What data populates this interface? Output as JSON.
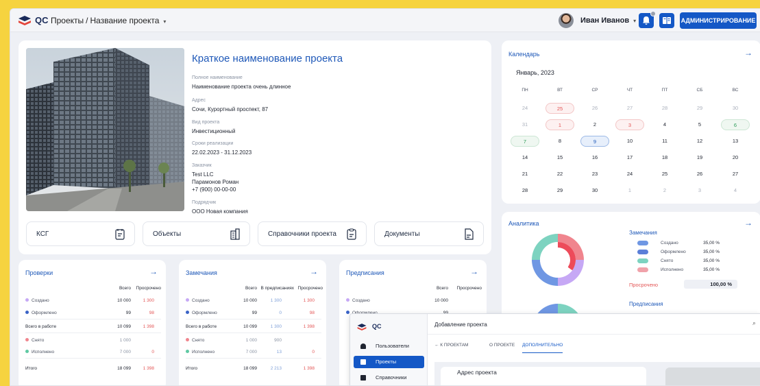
{
  "topbar": {
    "brand": "QC",
    "breadcrumb": [
      "Проекты",
      "Название проекта"
    ],
    "separator": "/",
    "user_name": "Иван Иванов",
    "admin_label": "АДМИНИСТРИРОВАНИЕ",
    "accent": "#1458c6"
  },
  "project": {
    "title": "Краткое наименование проекта",
    "fields": [
      {
        "label": "Полное наименование",
        "value": "Наименование проекта очень длинное"
      },
      {
        "label": "Адрес",
        "value": "Сочи, Курортный проспект, 87"
      },
      {
        "label": "Вид проекта",
        "value": "Инвестиционный"
      },
      {
        "label": "Сроки реализации",
        "value": "22.02.2023 - 31.12.2023"
      },
      {
        "label": "Заказчик",
        "lines": [
          "Test LLC",
          "Парамонов Роман",
          "+7 (900) 00-00-00"
        ]
      },
      {
        "label": "Подрядчик",
        "value": "ООО Новая компания"
      }
    ],
    "links": [
      "КСГ",
      "Объекты",
      "Справочники проекта",
      "Документы"
    ]
  },
  "checks": {
    "title": "Проверки",
    "headers": [
      "Всего",
      "Просрочено"
    ],
    "rows": [
      {
        "label": "Создано",
        "total": "10 000",
        "overdue": "1 300"
      },
      {
        "label": "Оформлено",
        "total": "99",
        "overdue": "98"
      },
      {
        "label": "Всего в работе",
        "total": "10 099",
        "overdue": "1 398"
      },
      {
        "label": "Снято",
        "total": "1 000",
        "overdue": ""
      },
      {
        "label": "Исполнено",
        "total": "7 000",
        "overdue": "0"
      },
      {
        "label": "Итого",
        "total": "18 099",
        "overdue": "1 398"
      }
    ]
  },
  "remarks": {
    "title": "Замечания",
    "headers": [
      "Всего",
      "В предписаниях",
      "Просрочено"
    ],
    "rows": [
      {
        "label": "Создано",
        "total": "10 000",
        "mid": "1 300",
        "overdue": "1 300"
      },
      {
        "label": "Оформлено",
        "total": "99",
        "mid": "0",
        "overdue": "98"
      },
      {
        "label": "Всего в работе",
        "total": "10 099",
        "mid": "1 300",
        "overdue": "1 398"
      },
      {
        "label": "Снято",
        "total": "1 000",
        "mid": "900",
        "overdue": ""
      },
      {
        "label": "Исполнено",
        "total": "7 000",
        "mid": "13",
        "overdue": "0"
      },
      {
        "label": "Итого",
        "total": "18 099",
        "mid": "2 213",
        "overdue": "1 398"
      }
    ]
  },
  "prescriptions": {
    "title": "Предписания",
    "headers": [
      "Всего",
      "Просрочено"
    ],
    "rows": [
      {
        "label": "Создано",
        "total": "10 000"
      },
      {
        "label": "Оформлено",
        "total": "99"
      }
    ]
  },
  "calendar": {
    "title": "Календарь",
    "month": "Январь, 2023",
    "weekdays": [
      "ПН",
      "ВТ",
      "СР",
      "ЧТ",
      "ПТ",
      "СБ",
      "ВС"
    ],
    "weeks": [
      [
        "24",
        "25",
        "26",
        "27",
        "28",
        "29",
        "30"
      ],
      [
        "31",
        "1",
        "2",
        "3",
        "4",
        "5",
        "6"
      ],
      [
        "7",
        "8",
        "9",
        "10",
        "11",
        "12",
        "13"
      ],
      [
        "14",
        "15",
        "16",
        "17",
        "18",
        "19",
        "20"
      ],
      [
        "21",
        "22",
        "23",
        "24",
        "25",
        "26",
        "27"
      ],
      [
        "28",
        "29",
        "30",
        "1",
        "2",
        "3",
        "4"
      ]
    ]
  },
  "analytics": {
    "title": "Аналитика",
    "remarks_title": "Замечания",
    "legend": [
      {
        "label": "Создано",
        "value": "35,00 %",
        "color": "#6f97e3"
      },
      {
        "label": "Оформлено",
        "value": "35,00 %",
        "color": "#5b7fd8"
      },
      {
        "label": "Снято",
        "value": "35,00 %",
        "color": "#7dd3c0"
      },
      {
        "label": "Исполнено",
        "value": "35,00 %",
        "color": "#f0a2aa"
      }
    ],
    "overdue_label": "Просрочено",
    "overdue_value": "100,00 %",
    "prescriptions_title": "Предписания"
  },
  "mini_app": {
    "brand": "QC",
    "nav": [
      "Пользователи",
      "Проекты",
      "Справочники"
    ],
    "header": "Добавление проекта",
    "back": "← К ПРОЕКТАМ",
    "tabs": [
      "О ПРОЕКТЕ",
      "ДОПОЛНИТЕЛЬНО"
    ],
    "section": "Адрес проекта"
  }
}
